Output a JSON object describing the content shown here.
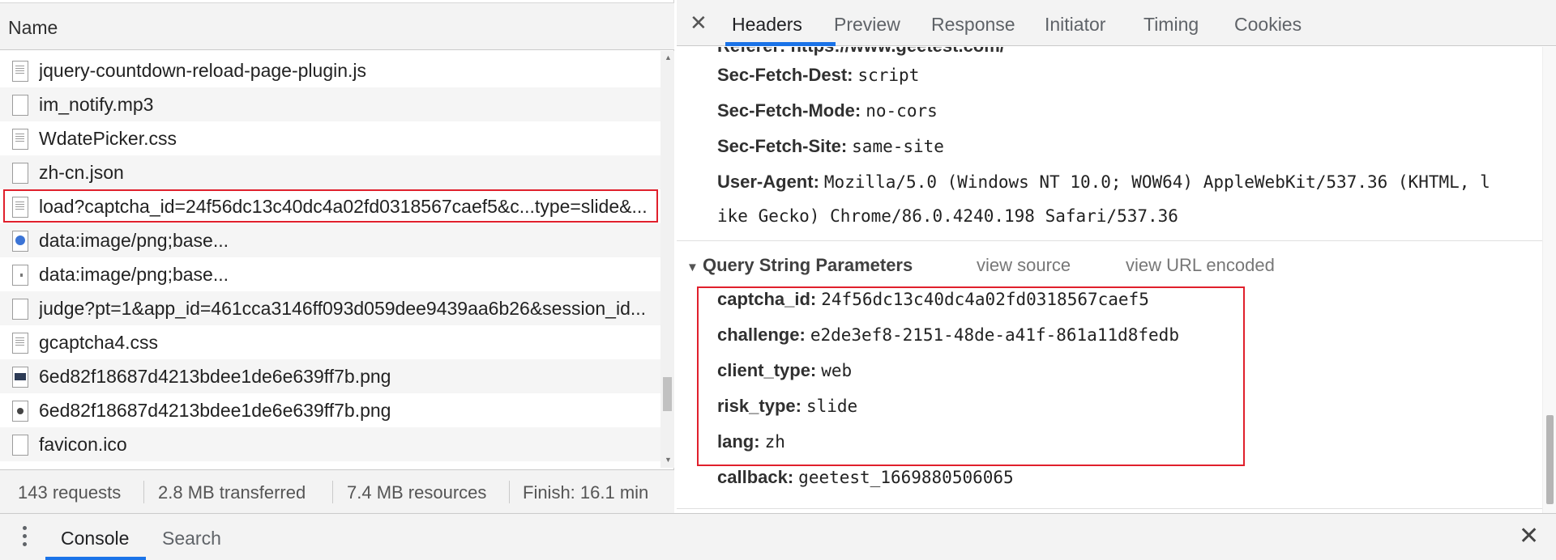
{
  "network_list": {
    "header_label": "Name",
    "requests": [
      {
        "name": "jquery-countdown-reload-page-plugin.js",
        "icon": "script-file-icon"
      },
      {
        "name": "im_notify.mp3",
        "icon": "blank-file-icon"
      },
      {
        "name": "WdatePicker.css",
        "icon": "stylesheet-file-icon"
      },
      {
        "name": "zh-cn.json",
        "icon": "blank-file-icon"
      },
      {
        "name": "load?captcha_id=24f56dc13c40dc4a02fd0318567caef5&c...type=slide&...",
        "icon": "script-file-icon"
      },
      {
        "name": "data:image/png;base...",
        "icon": "image-file-icon"
      },
      {
        "name": "data:image/png;base...",
        "icon": "image-file-icon"
      },
      {
        "name": "judge?pt=1&app_id=461cca3146ff093d059dee9439aa6b26&session_id...",
        "icon": "blank-file-icon"
      },
      {
        "name": "gcaptcha4.css",
        "icon": "stylesheet-file-icon"
      },
      {
        "name": "6ed82f18687d4213bdee1de6e639ff7b.png",
        "icon": "image-file-icon"
      },
      {
        "name": "6ed82f18687d4213bdee1de6e639ff7b.png",
        "icon": "image-file-icon"
      },
      {
        "name": "favicon.ico",
        "icon": "blank-file-icon"
      }
    ]
  },
  "status_bar": {
    "requests": "143 requests",
    "transferred": "2.8 MB transferred",
    "resources": "7.4 MB resources",
    "finish": "Finish: 16.1 min"
  },
  "detail_tabs": {
    "close_glyph": "✕",
    "tabs": [
      "Headers",
      "Preview",
      "Response",
      "Initiator",
      "Timing",
      "Cookies"
    ],
    "active_tab": "Headers"
  },
  "request_headers": {
    "partial_row": "Referer: https://www.geetest.com/",
    "rows": [
      {
        "key": "Sec-Fetch-Dest:",
        "value": "script"
      },
      {
        "key": "Sec-Fetch-Mode:",
        "value": "no-cors"
      },
      {
        "key": "Sec-Fetch-Site:",
        "value": "same-site"
      },
      {
        "key": "User-Agent:",
        "value": "Mozilla/5.0 (Windows NT 10.0; WOW64) AppleWebKit/537.36 (KHTML, l"
      }
    ],
    "user_agent_continuation": "ike Gecko) Chrome/86.0.4240.198 Safari/537.36"
  },
  "query_string": {
    "title": "Query String Parameters",
    "view_source": "view source",
    "view_url_encoded": "view URL encoded",
    "params": [
      {
        "key": "captcha_id:",
        "value": "24f56dc13c40dc4a02fd0318567caef5"
      },
      {
        "key": "challenge:",
        "value": "e2de3ef8-2151-48de-a41f-861a11d8fedb"
      },
      {
        "key": "client_type:",
        "value": "web"
      },
      {
        "key": "risk_type:",
        "value": "slide"
      },
      {
        "key": "lang:",
        "value": "zh"
      },
      {
        "key": "callback:",
        "value": "geetest_1669880506065"
      }
    ]
  },
  "drawer": {
    "tabs": [
      "Console",
      "Search"
    ],
    "active_tab": "Console",
    "close_glyph": "✕"
  },
  "colors": {
    "highlight_border": "#e0202c",
    "active_tab_underline": "#1a73e8",
    "panel_background": "#f3f3f3"
  }
}
